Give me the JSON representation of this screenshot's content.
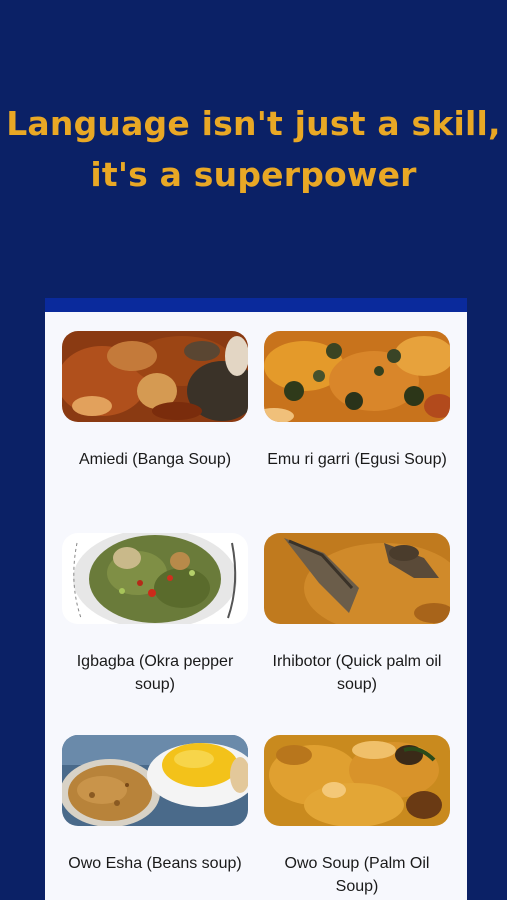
{
  "headline": {
    "line1": "Language isn't just a skill,",
    "line2": "it's a superpower"
  },
  "colors": {
    "background": "#0b2166",
    "headline": "#e9a825",
    "card": "#f7f8fd",
    "card_bar": "#0a2a9c"
  },
  "soups": [
    {
      "name": "Amiedi (Banga Soup)",
      "image": "banga-soup-photo"
    },
    {
      "name": "Emu ri garri (Egusi Soup)",
      "image": "egusi-soup-photo"
    },
    {
      "name": "Igbagba (Okra pepper soup)",
      "image": "okra-pepper-soup-photo"
    },
    {
      "name": "Irhibotor (Quick palm oil soup)",
      "image": "palm-oil-fish-soup-photo"
    },
    {
      "name": "Owo Esha (Beans soup)",
      "image": "beans-soup-photo"
    },
    {
      "name": "Owo Soup (Palm Oil Soup)",
      "image": "owo-soup-photo"
    }
  ]
}
